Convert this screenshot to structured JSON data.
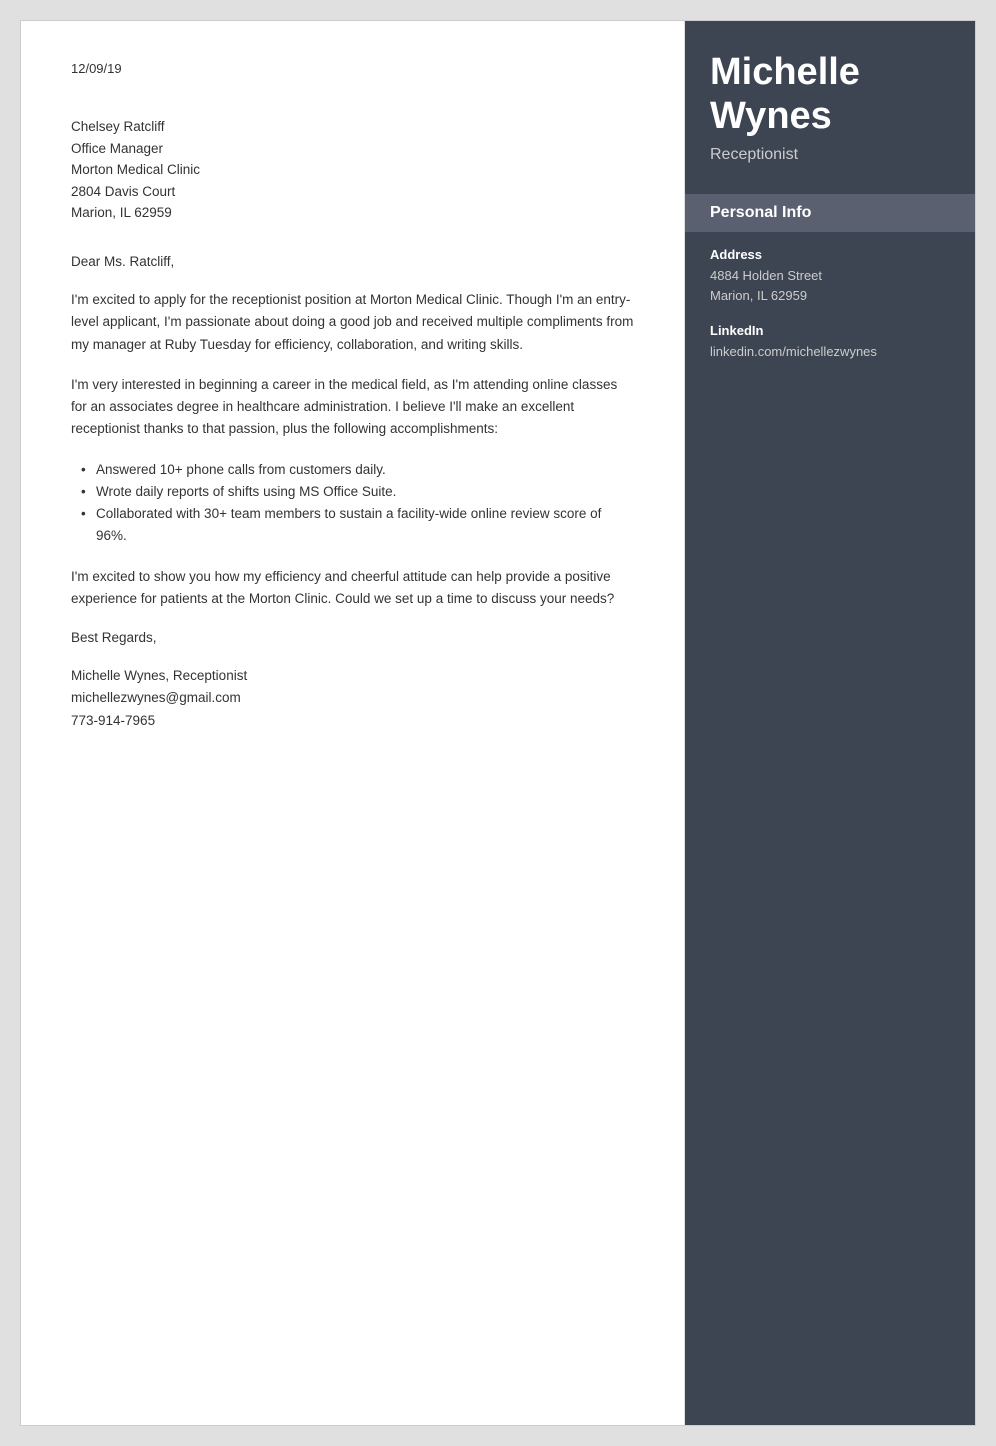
{
  "page": {
    "date": "12/09/19",
    "recipient": {
      "name": "Chelsey Ratcliff",
      "title": "Office Manager",
      "company": "Morton Medical Clinic",
      "address": "2804 Davis Court",
      "city_state_zip": "Marion, IL 62959"
    },
    "salutation": "Dear Ms. Ratcliff,",
    "paragraphs": [
      "I'm excited to apply for the receptionist position at Morton Medical Clinic. Though I'm an entry-level applicant, I'm passionate about doing a good job and received multiple compliments from my manager at Ruby Tuesday for efficiency, collaboration, and writing skills.",
      "I'm very interested in beginning a career in the medical field, as I'm attending online classes for an associates degree in healthcare administration. I believe I'll make an excellent receptionist thanks to that passion, plus the following accomplishments:"
    ],
    "bullets": [
      "Answered 10+ phone calls from customers daily.",
      "Wrote daily reports of shifts using MS Office Suite.",
      "Collaborated with 30+ team members to sustain a facility-wide online review score of 96%."
    ],
    "closing_paragraph": "I'm excited to show you how my efficiency and cheerful attitude can help provide a positive experience for patients at the Morton Clinic. Could we set up a time to discuss your needs?",
    "closing": "Best Regards,",
    "signature": {
      "name_title": "Michelle Wynes, Receptionist",
      "email": "michellezwynes@gmail.com",
      "phone": "773-914-7965"
    }
  },
  "sidebar": {
    "name_line1": "Michelle",
    "name_line2": "Wynes",
    "job_title": "Receptionist",
    "personal_info_heading": "Personal Info",
    "address_label": "Address",
    "address_line1": "4884 Holden Street",
    "address_line2": "Marion, IL 62959",
    "linkedin_label": "LinkedIn",
    "linkedin_value": "linkedin.com/michellezwynes"
  }
}
